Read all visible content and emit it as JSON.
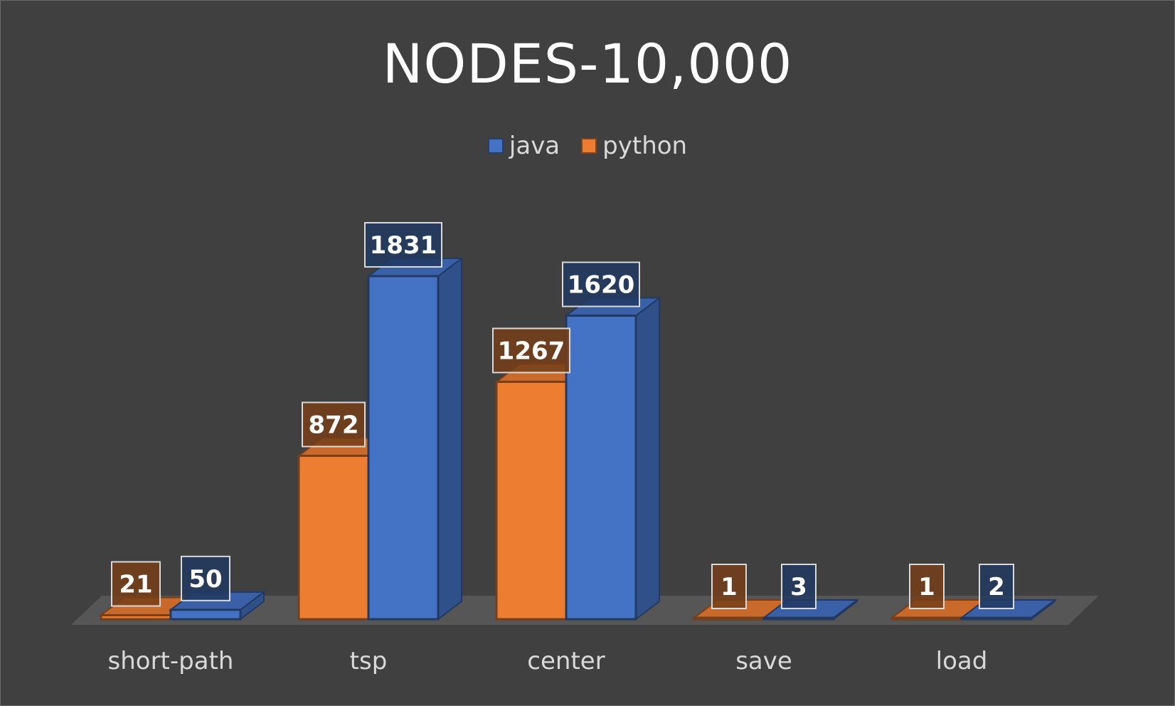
{
  "chart_data": {
    "type": "bar",
    "title": "NODES-10,000",
    "categories": [
      "short-path",
      "tsp",
      "center",
      "save",
      "load"
    ],
    "series": [
      {
        "name": "python",
        "values": [
          21,
          872,
          1267,
          1,
          1
        ],
        "color": "#ED7D31"
      },
      {
        "name": "java",
        "values": [
          50,
          1831,
          1620,
          3,
          2
        ],
        "color": "#4472C4"
      }
    ],
    "legend_order": [
      "java",
      "python"
    ],
    "legend_position": "top",
    "ylim": [
      0,
      2000
    ],
    "grid": false,
    "style": "3d-clustered-column"
  }
}
